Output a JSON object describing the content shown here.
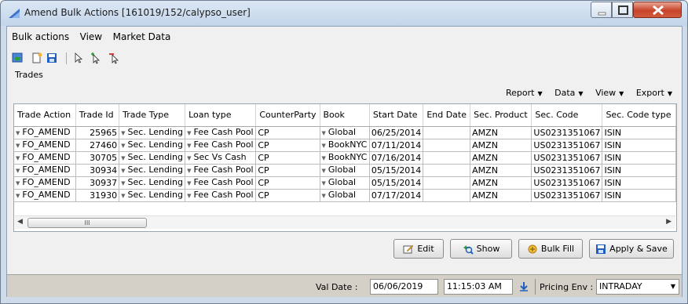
{
  "window": {
    "title": "Amend Bulk Actions [161019/152/calypso_user]"
  },
  "menubar": [
    "Bulk actions",
    "View",
    "Market Data"
  ],
  "trades": {
    "label": "Trades",
    "tools": [
      "Report",
      "Data",
      "View",
      "Export"
    ],
    "columns": [
      "Trade Action",
      "Trade Id",
      "Trade Type",
      "Loan type",
      "CounterParty",
      "Book",
      "Start Date",
      "End Date",
      "Sec. Product",
      "Sec. Code",
      "Sec. Code type"
    ],
    "rows": [
      [
        "FO_AMEND",
        "25965",
        "Sec. Lending",
        "Fee Cash Pool",
        "CP",
        "Global",
        "06/25/2014",
        "",
        "AMZN",
        "US0231351067",
        "ISIN"
      ],
      [
        "FO_AMEND",
        "27460",
        "Sec. Lending",
        "Fee Cash Pool",
        "CP",
        "BookNYC",
        "07/11/2014",
        "",
        "AMZN",
        "US0231351067",
        "ISIN"
      ],
      [
        "FO_AMEND",
        "30705",
        "Sec. Lending",
        "Sec Vs Cash",
        "CP",
        "BookNYC",
        "07/16/2014",
        "",
        "AMZN",
        "US0231351067",
        "ISIN"
      ],
      [
        "FO_AMEND",
        "30934",
        "Sec. Lending",
        "Fee Cash Pool",
        "CP",
        "Global",
        "05/15/2014",
        "",
        "AMZN",
        "US0231351067",
        "ISIN"
      ],
      [
        "FO_AMEND",
        "30937",
        "Sec. Lending",
        "Fee Cash Pool",
        "CP",
        "Global",
        "05/15/2014",
        "",
        "AMZN",
        "US0231351067",
        "ISIN"
      ],
      [
        "FO_AMEND",
        "31930",
        "Sec. Lending",
        "Fee Cash Pool",
        "CP",
        "Global",
        "07/17/2014",
        "",
        "AMZN",
        "US0231351067",
        "ISIN"
      ]
    ],
    "scroll_grip": "III"
  },
  "buttons": {
    "edit": "Edit",
    "show": "Show",
    "bulk_fill": "Bulk Fill",
    "apply_save": "Apply & Save"
  },
  "footer": {
    "val_date_label": "Val Date :",
    "val_date": "06/06/2019",
    "time": "11:15:03 AM",
    "pricing_env_label": "Pricing Env :",
    "pricing_env": "INTRADAY"
  },
  "colors": {
    "title_bar": "#c3d5ea",
    "close_button": "#c7442b",
    "grid_border": "#9aa6b5",
    "icon_blue": "#1f5fbf"
  }
}
